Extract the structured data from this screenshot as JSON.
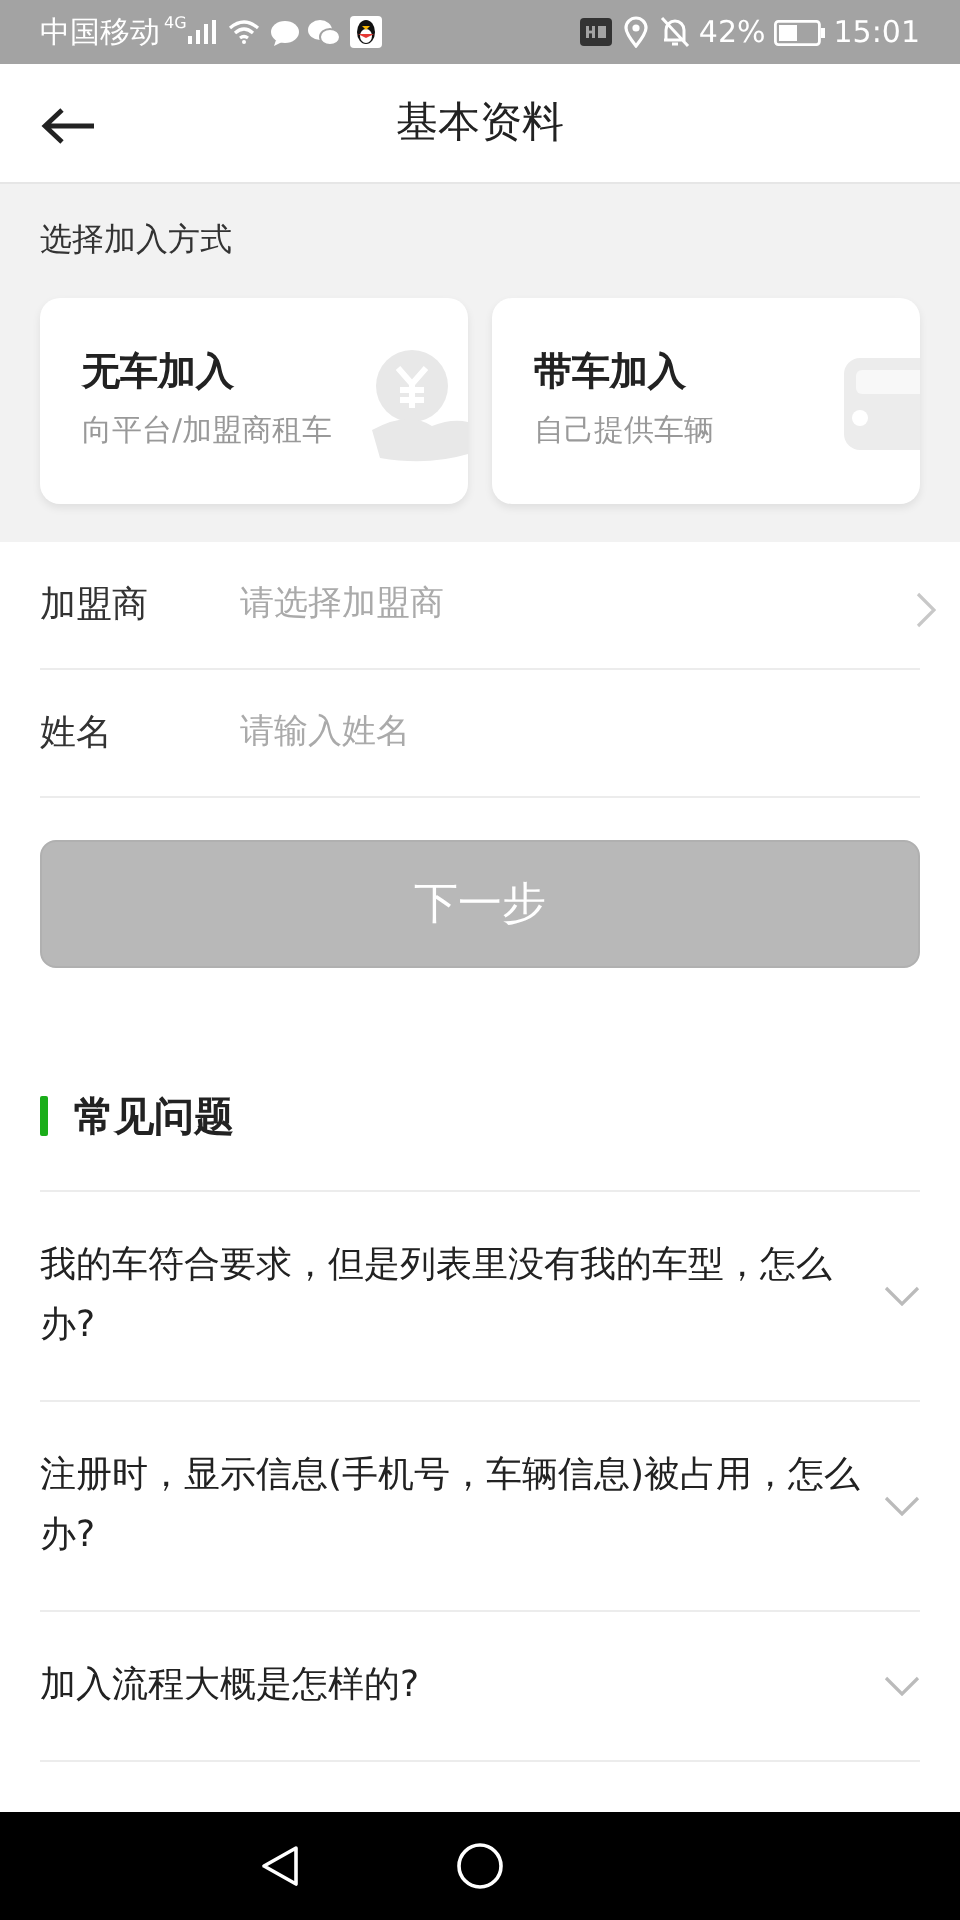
{
  "status_bar": {
    "carrier": "中国移动",
    "network": "4G",
    "battery": "42%",
    "time": "15:01"
  },
  "header": {
    "title": "基本资料"
  },
  "join": {
    "label": "选择加入方式",
    "options": [
      {
        "kind": "rent",
        "title": "无车加入",
        "subtitle": "向平台/加盟商租车"
      },
      {
        "kind": "own",
        "title": "带车加入",
        "subtitle": "自己提供车辆"
      }
    ]
  },
  "form": [
    {
      "label": "加盟商",
      "placeholder": "请选择加盟商",
      "kind": "select"
    },
    {
      "label": "姓名",
      "placeholder": "请输入姓名",
      "kind": "input"
    }
  ],
  "next_button": {
    "label": "下一步",
    "disabled": true
  },
  "faq": {
    "title": "常见问题",
    "items": [
      {
        "question": "我的车符合要求，但是列表里没有我的车型，怎么办?",
        "expanded": false
      },
      {
        "question": "注册时，显示信息(手机号，车辆信息)被占用，怎么办?",
        "expanded": false
      },
      {
        "question": "加入流程大概是怎样的?",
        "expanded": false
      }
    ]
  }
}
